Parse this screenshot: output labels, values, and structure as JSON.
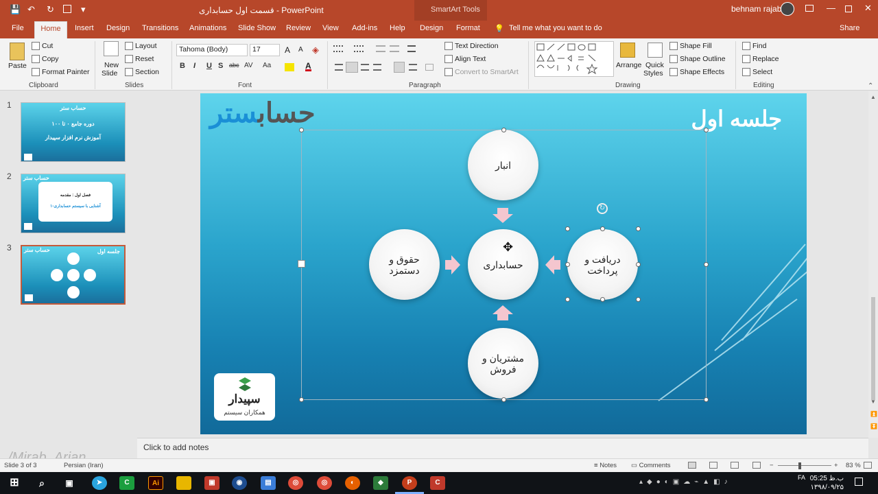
{
  "titlebar": {
    "doc_title": "قسمت اول حسابداری - PowerPoint",
    "smartart_tools": "SmartArt Tools",
    "user": "behnam rajabi",
    "qa_save": "💾",
    "qa_undo": "↶",
    "qa_redo": "↻",
    "qa_customize": "▾"
  },
  "tabs": {
    "file": "File",
    "home": "Home",
    "insert": "Insert",
    "design": "Design",
    "transitions": "Transitions",
    "animations": "Animations",
    "slide_show": "Slide Show",
    "review": "Review",
    "view": "View",
    "addins": "Add-ins",
    "help": "Help",
    "sa_design": "Design",
    "sa_format": "Format",
    "tell_me": "Tell me what you want to do",
    "share": "Share"
  },
  "ribbon": {
    "clipboard": {
      "label": "Clipboard",
      "paste": "Paste",
      "cut": "Cut",
      "copy": "Copy",
      "format_painter": "Format Painter"
    },
    "slides": {
      "label": "Slides",
      "new_slide_1": "New",
      "new_slide_2": "Slide",
      "layout": "Layout",
      "reset": "Reset",
      "section": "Section"
    },
    "font": {
      "label": "Font",
      "name": "Tahoma (Body)",
      "size": "17",
      "bold": "B",
      "italic": "I",
      "underline": "U",
      "shadow": "S",
      "strike": "abc",
      "spacing": "AV",
      "case": "Aa",
      "grow": "A",
      "shrink": "A"
    },
    "paragraph": {
      "label": "Paragraph",
      "text_direction": "Text Direction",
      "align_text": "Align Text",
      "convert_smartart": "Convert to SmartArt"
    },
    "drawing": {
      "label": "Drawing",
      "arrange": "Arrange",
      "quick_styles_1": "Quick",
      "quick_styles_2": "Styles",
      "shape_fill": "Shape Fill",
      "shape_outline": "Shape Outline",
      "shape_effects": "Shape Effects"
    },
    "editing": {
      "label": "Editing",
      "find": "Find",
      "replace": "Replace",
      "select": "Select"
    }
  },
  "slides_panel": [
    {
      "num": "1",
      "l1": "حساب ستر",
      "l2": "دوره جامع ۰ تا ۱۰۰",
      "l3": "آموزش نرم افزار سپیدار"
    },
    {
      "num": "2",
      "l1": "حساب ستر",
      "l2": "فصل اول : مقدمه",
      "l3": "۱-آشنایی با سیستم حسابداری"
    },
    {
      "num": "3",
      "l1": "حساب ستر",
      "l2": "جلسه اول",
      "l3": ""
    }
  ],
  "slide": {
    "logo_main": "حساب",
    "logo_accent": "ستر",
    "title": "جلسه اول",
    "nodes": {
      "top": "انبار",
      "center": "حسابداری",
      "left_1": "حقوق و",
      "left_2": "دستمزد",
      "right_1": "دریافت و",
      "right_2": "پرداخت",
      "bottom_1": "مشتریان و",
      "bottom_2": "فروش"
    },
    "brand_name": "سپیدار",
    "brand_sub": "همکاران سیستم"
  },
  "notes": {
    "placeholder": "Click to add notes"
  },
  "status": {
    "slide": "Slide 3 of 3",
    "language": "Persian (Iran)",
    "notes": "Notes",
    "comments": "Comments",
    "zoom": "83 %"
  },
  "watermark": "/Mirab_Arian",
  "taskbar": {
    "time": "05:25 ب.ظ",
    "date": "۱۳۹۸/۰۹/۲۵",
    "lang": "FA"
  },
  "colors": {
    "accent": "#b7472a",
    "slide_top": "#5ed4ec",
    "slide_bottom": "#116a9a"
  }
}
